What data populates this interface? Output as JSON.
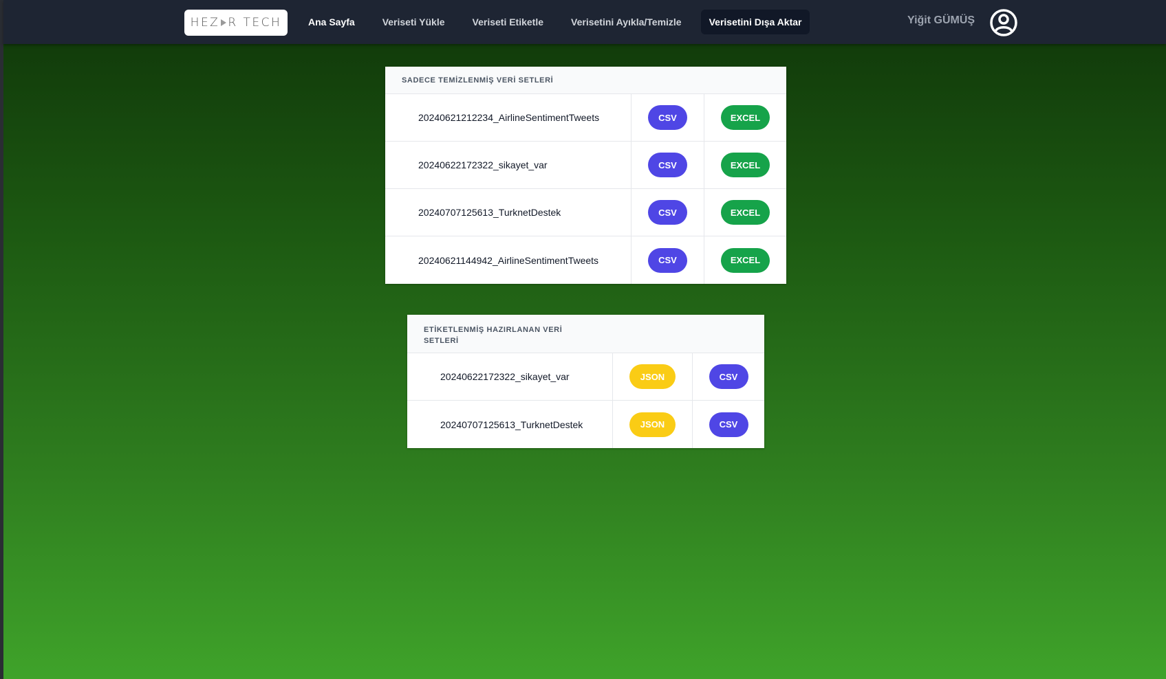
{
  "navbar": {
    "logo_text": "HEZ",
    "logo_text_end": "R TECH",
    "links": [
      {
        "label": "Ana Sayfa"
      },
      {
        "label": "Veriseti Yükle"
      },
      {
        "label": "Veriseti Etiketle"
      },
      {
        "label": "Verisetini Ayıkla/Temizle"
      },
      {
        "label": "Verisetini Dışa Aktar",
        "active": true
      }
    ],
    "user_name": "Yiğit GÜMÜŞ",
    "avatar_icon": "user-circle-icon"
  },
  "cleaned_datasets": {
    "title": "SADECE TEMİZLENMİŞ VERİ SETLERİ",
    "rows": [
      {
        "name": "20240621212234_AirlineSentimentTweets",
        "csv": "CSV",
        "excel": "EXCEL"
      },
      {
        "name": "20240622172322_sikayet_var",
        "csv": "CSV",
        "excel": "EXCEL"
      },
      {
        "name": "20240707125613_TurknetDestek",
        "csv": "CSV",
        "excel": "EXCEL"
      },
      {
        "name": "20240621144942_AirlineSentimentTweets",
        "csv": "CSV",
        "excel": "EXCEL"
      }
    ]
  },
  "labeled_datasets": {
    "title": "ETİKETLENMİŞ HAZIRLANAN VERİ SETLERİ",
    "rows": [
      {
        "name": "20240622172322_sikayet_var",
        "json": "JSON",
        "csv": "CSV"
      },
      {
        "name": "20240707125613_TurknetDestek",
        "json": "JSON",
        "csv": "CSV"
      }
    ]
  },
  "colors": {
    "navbar": "#1e2533",
    "csv_button": "#4f46e5",
    "excel_button": "#16a34a",
    "json_button": "#facc15",
    "background_top": "#0f3509",
    "background_bottom": "#3fa32a"
  }
}
